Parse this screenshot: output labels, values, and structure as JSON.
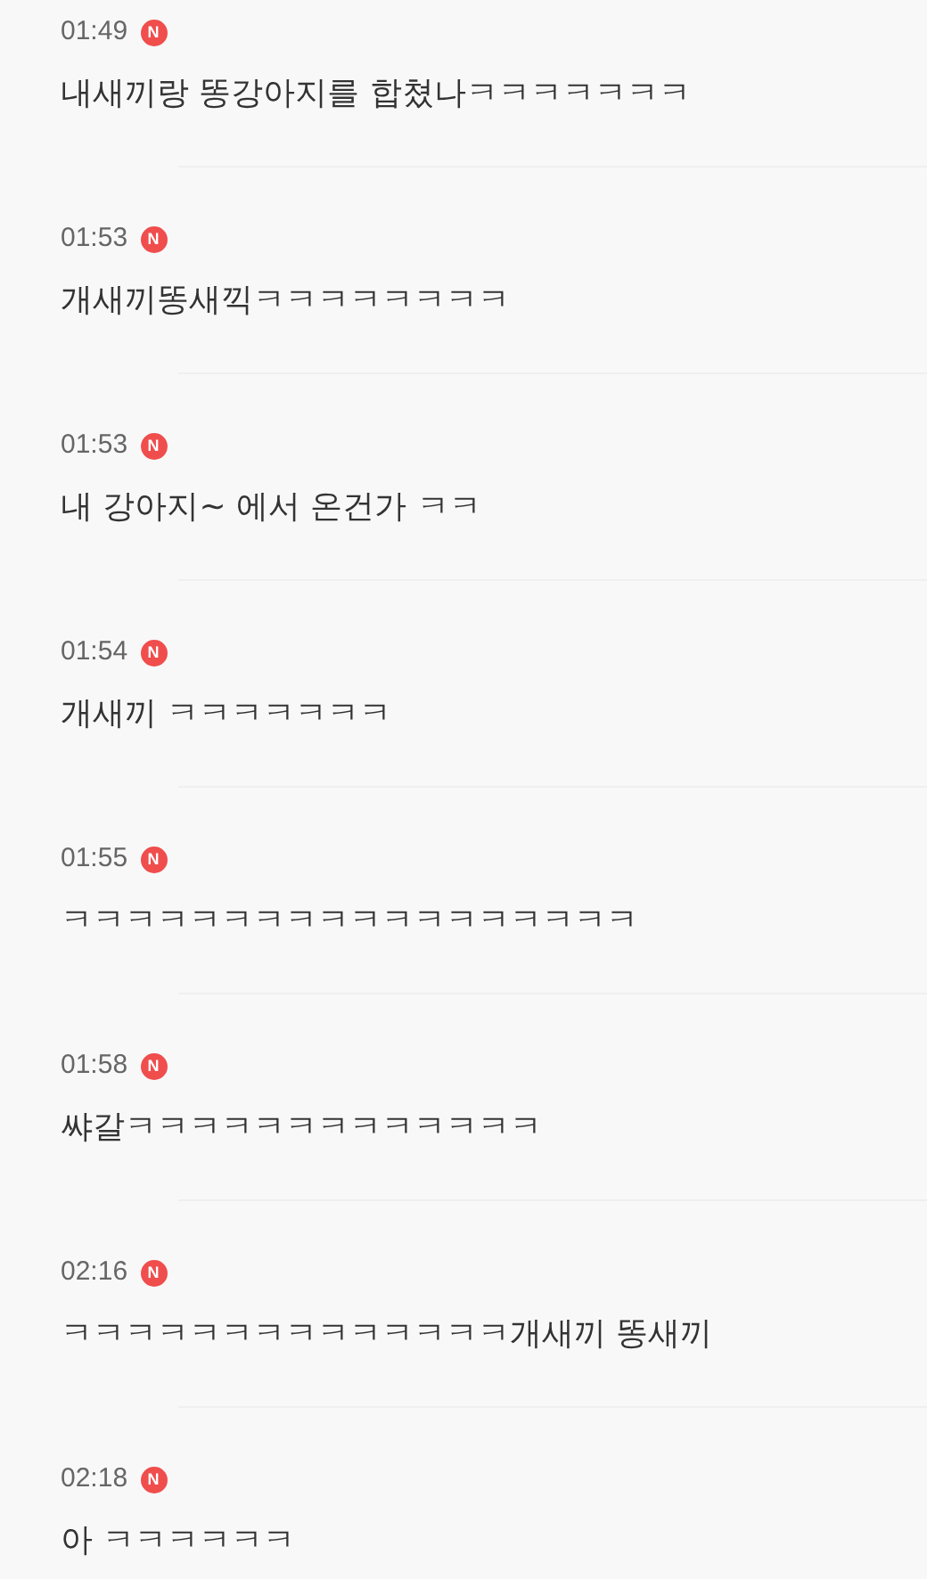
{
  "comments": [
    {
      "time": "01:49",
      "badge": "N",
      "text": "내새끼랑 똥강아지를 합쳤나ㅋㅋㅋㅋㅋㅋㅋ"
    },
    {
      "time": "01:53",
      "badge": "N",
      "text": "개새끼똥새끽ㅋㅋㅋㅋㅋㅋㅋㅋ"
    },
    {
      "time": "01:53",
      "badge": "N",
      "text": "내 강아지~ 에서 온건가 ㅋㅋ"
    },
    {
      "time": "01:54",
      "badge": "N",
      "text": "개새끼 ㅋㅋㅋㅋㅋㅋㅋ"
    },
    {
      "time": "01:55",
      "badge": "N",
      "text": "ㅋㅋㅋㅋㅋㅋㅋㅋㅋㅋㅋㅋㅋㅋㅋㅋㅋㅋ"
    },
    {
      "time": "01:58",
      "badge": "N",
      "text": "쌰갈ㅋㅋㅋㅋㅋㅋㅋㅋㅋㅋㅋㅋㅋ"
    },
    {
      "time": "02:16",
      "badge": "N",
      "text": "ㅋㅋㅋㅋㅋㅋㅋㅋㅋㅋㅋㅋㅋㅋ개새끼 똥새끼"
    },
    {
      "time": "02:18",
      "badge": "N",
      "text": "아 ㅋㅋㅋㅋㅋㅋ"
    }
  ]
}
